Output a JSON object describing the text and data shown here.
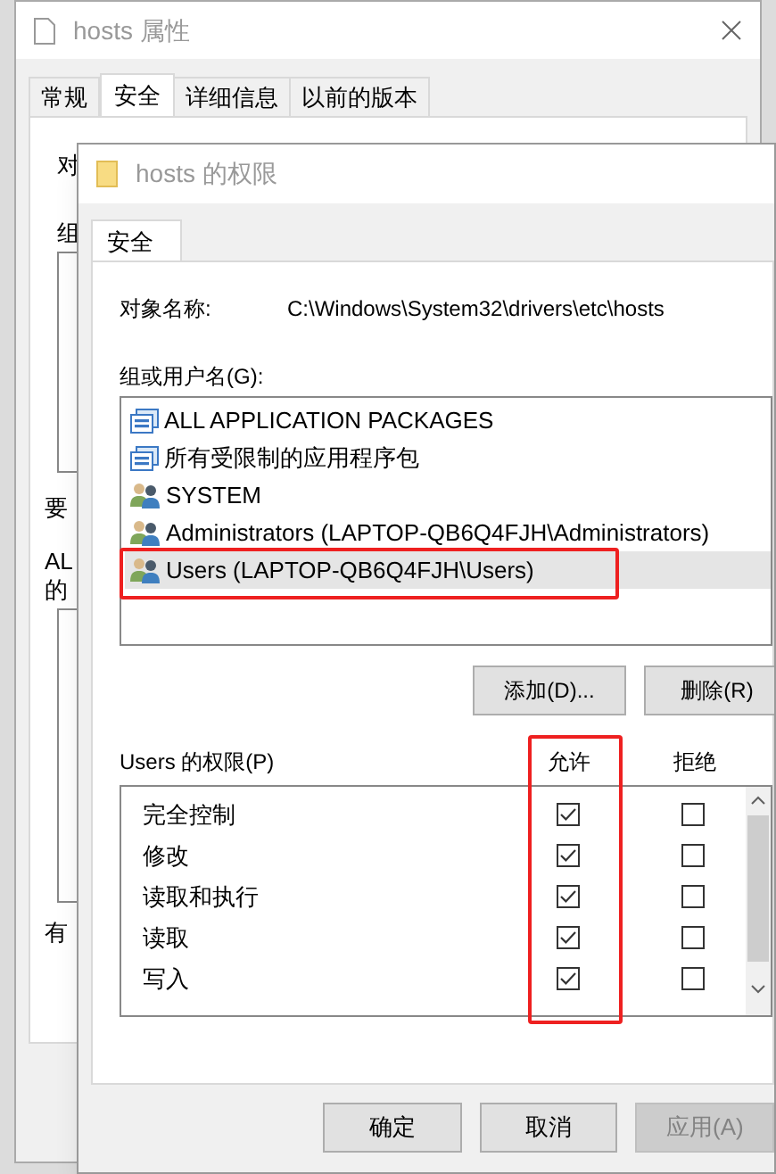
{
  "background_window": {
    "title": "hosts 属性",
    "tabs": [
      {
        "label": "常规",
        "selected": false
      },
      {
        "label": "安全",
        "selected": true
      },
      {
        "label": "详细信息",
        "selected": false
      },
      {
        "label": "以前的版本",
        "selected": false
      }
    ],
    "visible_labels": [
      "对",
      "组",
      "要",
      "AL",
      "的",
      "有"
    ]
  },
  "dialog": {
    "title": "hosts 的权限",
    "tabs": [
      {
        "label": "安全",
        "selected": true
      }
    ],
    "object_name_label": "对象名称:",
    "object_name": "C:\\Windows\\System32\\drivers\\etc\\hosts",
    "group_label": "组或用户名(G):",
    "principals": [
      {
        "name": "ALL APPLICATION PACKAGES",
        "kind": "package",
        "selected": false
      },
      {
        "name": "所有受限制的应用程序包",
        "kind": "package",
        "selected": false
      },
      {
        "name": "SYSTEM",
        "kind": "group",
        "selected": false
      },
      {
        "name": "Administrators (LAPTOP-QB6Q4FJH\\Administrators)",
        "kind": "group",
        "selected": false
      },
      {
        "name": "Users (LAPTOP-QB6Q4FJH\\Users)",
        "kind": "group",
        "selected": true
      }
    ],
    "add_button": "添加(D)...",
    "remove_button": "删除(R)",
    "permissions_label": "Users 的权限(P)",
    "columns": [
      "允许",
      "拒绝"
    ],
    "permissions": [
      {
        "name": "完全控制",
        "allow": true,
        "deny": false
      },
      {
        "name": "修改",
        "allow": true,
        "deny": false
      },
      {
        "name": "读取和执行",
        "allow": true,
        "deny": false
      },
      {
        "name": "读取",
        "allow": true,
        "deny": false
      },
      {
        "name": "写入",
        "allow": true,
        "deny": false
      }
    ],
    "buttons": [
      {
        "label": "确定",
        "disabled": false
      },
      {
        "label": "取消",
        "disabled": false
      },
      {
        "label": "应用(A)",
        "disabled": true
      }
    ]
  }
}
